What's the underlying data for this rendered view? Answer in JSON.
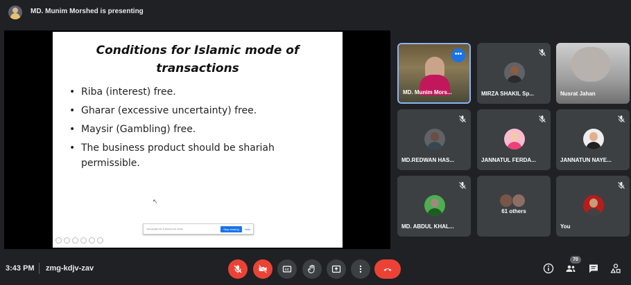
{
  "header": {
    "presenting_text": "MD. Munim Morshed is presenting"
  },
  "slide": {
    "title": "Conditions for Islamic mode of transactions",
    "bullets": [
      "Riba (interest) free.",
      "Gharar (excessive uncertainty) free.",
      "Maysir (Gambling) free.",
      "The business product should be shariah permissible."
    ],
    "share_notice": "meet.google.com is sharing your screen.",
    "stop_sharing_label": "Stop sharing",
    "hide_label": "Hide"
  },
  "participants": [
    {
      "name": "MD. Munim Mors...",
      "muted": false,
      "active": true
    },
    {
      "name": "MIRZA SHAKIL Sp...",
      "muted": true
    },
    {
      "name": "Nusrat Jahan",
      "muted": false
    },
    {
      "name": "MD.REDWAN HAS...",
      "muted": true
    },
    {
      "name": "JANNATUL FERDA...",
      "muted": true
    },
    {
      "name": "JANNATUN NAYE...",
      "muted": true
    },
    {
      "name": "MD. ABDUL KHAL...",
      "muted": true
    },
    {
      "name": "61 others",
      "muted": true
    },
    {
      "name": "You",
      "muted": true
    }
  ],
  "more_options_glyph": "•••",
  "bottom_bar": {
    "time": "3:43 PM",
    "meeting_code": "zmg-kdjv-zav",
    "people_count": "70"
  },
  "icons": {
    "mic": "mic-off-icon",
    "camera": "camera-off-icon",
    "captions": "captions-icon",
    "raise_hand": "raise-hand-icon",
    "present": "present-screen-icon",
    "more": "more-vert-icon",
    "leave": "end-call-icon",
    "info": "info-icon",
    "people": "people-icon",
    "chat": "chat-icon",
    "activities": "activities-icon"
  },
  "colors": {
    "background": "#202124",
    "tile": "#3c4043",
    "accent": "#8ab4f8",
    "danger": "#ea4335",
    "primary": "#1a73e8"
  }
}
